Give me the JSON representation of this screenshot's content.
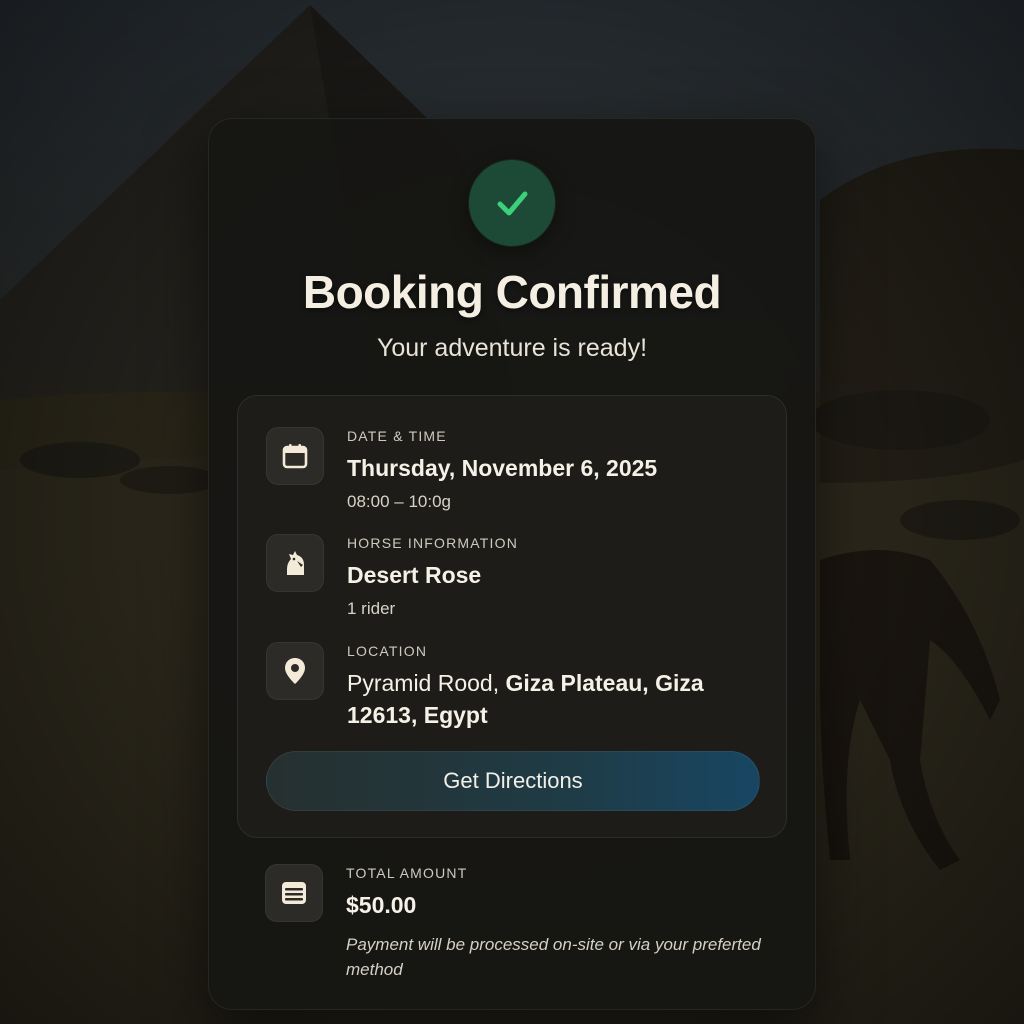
{
  "header": {
    "title": "Booking Confirmed",
    "subtitle": "Your adventure is ready!"
  },
  "details": {
    "datetime": {
      "icon": "calendar-icon",
      "label": "DATE & TIME",
      "value": "Thursday, November 6, 2025",
      "sub": "08:00 – 10:0g"
    },
    "horse": {
      "icon": "horse-icon",
      "label": "HORSE INFORMATION",
      "value": "Desert Rose",
      "sub": "1 rider"
    },
    "location": {
      "icon": "location-pin-icon",
      "label": "LOCATION",
      "value_light": "Pyramid Rood,",
      "value_bold": " Giza Plateau, Giza 12613, Egypt"
    },
    "directions_label": "Get Directions"
  },
  "payment": {
    "icon": "wallet-icon",
    "label": "TOTAL AMOUNT",
    "amount": "$50.00",
    "note": "Payment will be processed on-site or via your preferted method"
  },
  "colors": {
    "success_green": "#3dd07a",
    "button_blue": "#184663"
  }
}
